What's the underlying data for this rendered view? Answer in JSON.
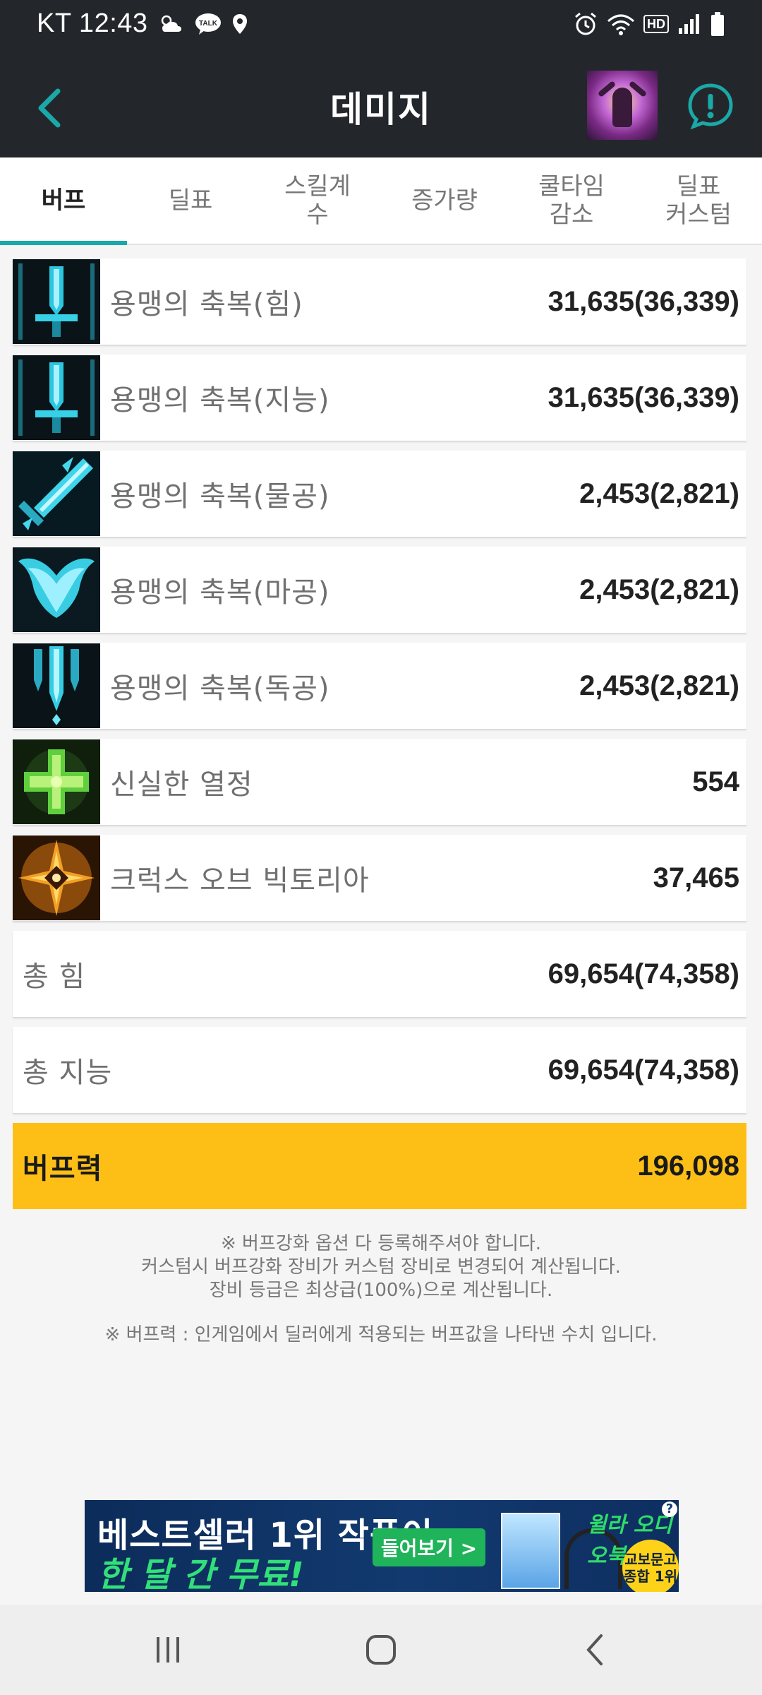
{
  "status_bar": {
    "carrier_time": "KT 12:43",
    "hd": "HD",
    "talk": "TALK"
  },
  "header": {
    "title": "데미지"
  },
  "tabs": [
    {
      "label": "버프",
      "active": true
    },
    {
      "label": "딜표",
      "active": false
    },
    {
      "label": "스킬계\n수",
      "active": false
    },
    {
      "label": "증가량",
      "active": false
    },
    {
      "label": "쿨타임\n감소",
      "active": false
    },
    {
      "label": "딜표\n커스텀",
      "active": false
    }
  ],
  "rows": [
    {
      "name": "용맹의 축복(힘)",
      "value": "31,635(36,339)",
      "icon": "sword-blessing-icon"
    },
    {
      "name": "용맹의 축복(지능)",
      "value": "31,635(36,339)",
      "icon": "sword-blessing-icon"
    },
    {
      "name": "용맹의 축복(물공)",
      "value": "2,453(2,821)",
      "icon": "slash-sword-icon"
    },
    {
      "name": "용맹의 축복(마공)",
      "value": "2,453(2,821)",
      "icon": "wings-icon"
    },
    {
      "name": "용맹의 축복(독공)",
      "value": "2,453(2,821)",
      "icon": "falling-swords-icon"
    },
    {
      "name": "신실한 열정",
      "value": "554",
      "icon": "green-cross-icon"
    },
    {
      "name": "크럭스 오브 빅토리아",
      "value": "37,465",
      "icon": "crux-sun-icon"
    }
  ],
  "totals": [
    {
      "name": "총 힘",
      "value": "69,654(74,358)"
    },
    {
      "name": "총 지능",
      "value": "69,654(74,358)"
    }
  ],
  "buff_power": {
    "name": "버프력",
    "value": "196,098",
    "color": "#fdbf16"
  },
  "notes": {
    "line1": "※ 버프강화 옵션 다 등록해주셔야 합니다.",
    "line2": "커스텀시 버프강화 장비가 커스텀 장비로 변경되어 계산됩니다.",
    "line3": "장비 등급은 최상급(100%)으로 계산됩니다.",
    "line4": "※ 버프력 : 인게임에서 딜러에게 적용되는 버프값을 나타낸 수치 입니다."
  },
  "ad": {
    "line1": "베스트셀러 1위 작품이",
    "line2": "한 달 간 무료!",
    "button": "들어보기 >",
    "brand": "윌라 오디오북",
    "badge": "교보문고\n종합 1위",
    "help": "?"
  },
  "colors": {
    "accent": "#1aa8a8",
    "header_bg": "#23272b",
    "highlight": "#fdbf16"
  }
}
